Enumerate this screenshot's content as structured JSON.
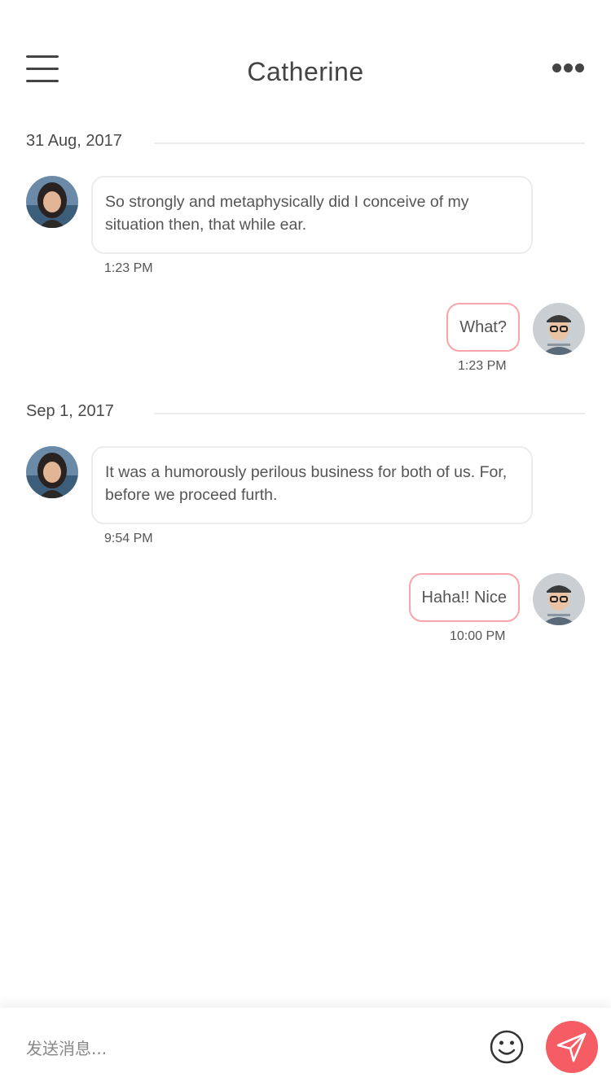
{
  "header": {
    "title": "Catherine",
    "menu_icon": "hamburger-menu-icon",
    "more_icon": "more-dots-icon"
  },
  "conversation": {
    "groups": [
      {
        "date": "31 Aug, 2017",
        "messages": [
          {
            "from": "contact",
            "text": "So strongly and metaphysically did I conceive of my situation then, that while ear.",
            "time": "1:23 PM"
          },
          {
            "from": "me",
            "text": "What?",
            "time": "1:23 PM"
          }
        ]
      },
      {
        "date": "Sep 1, 2017",
        "messages": [
          {
            "from": "contact",
            "text": "It was a humorously perilous business for both of us. For, before we proceed furth.",
            "time": "9:54 PM"
          },
          {
            "from": "me",
            "text": "Haha!! Nice",
            "time": "10:00 PM"
          }
        ]
      }
    ]
  },
  "composer": {
    "placeholder": "发送消息...",
    "emoji_icon": "smiley-face-icon",
    "send_icon": "paper-plane-send-icon"
  },
  "colors": {
    "accent": "#f55c63",
    "outgoing_border": "#f7a5aa",
    "incoming_border": "#ececec",
    "text": "#4a4a4a"
  }
}
